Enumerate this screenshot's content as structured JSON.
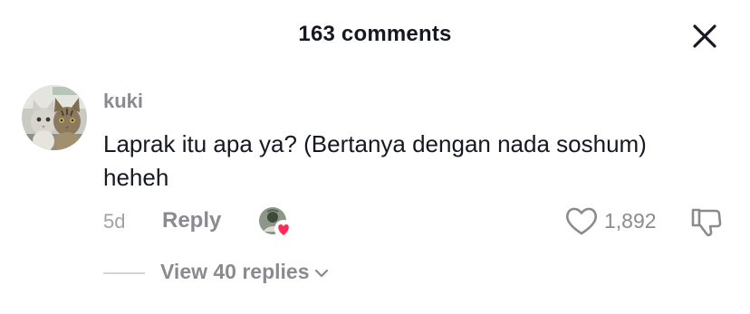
{
  "header": {
    "title": "163 comments",
    "close_icon": "close-icon"
  },
  "comment": {
    "avatar_icon": "cat-avatar",
    "username": "kuki",
    "text": "Laprak itu apa ya? (Bertanya dengan nada soshum) heheh",
    "time": "5d",
    "reply_label": "Reply",
    "creator_liked_icon": "creator-liked-heart-icon",
    "like_icon": "heart-outline-icon",
    "like_count": "1,892",
    "dislike_icon": "thumbs-down-icon",
    "view_replies_label": "View 40 replies",
    "view_replies_icon": "chevron-down-icon"
  },
  "colors": {
    "primary_text": "#161823",
    "secondary_text": "#8a8b91",
    "muted_text": "#a1a2a7",
    "heart_badge": "#fe2c55"
  }
}
